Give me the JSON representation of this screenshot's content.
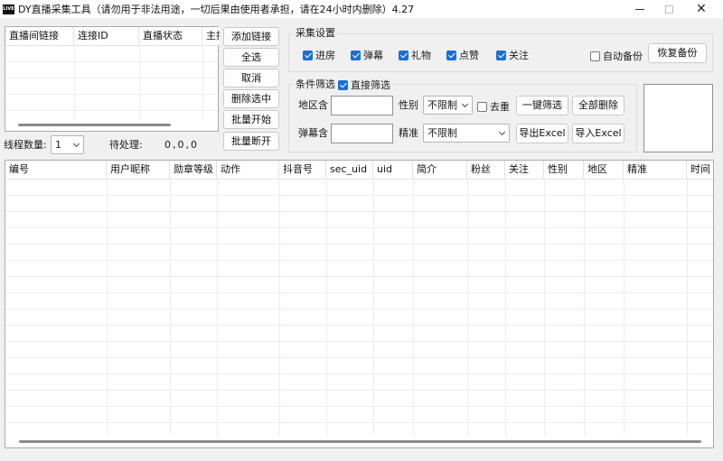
{
  "window": {
    "icon_text": "LIVE",
    "title": "DY直播采集工具（请勿用于非法用途，一切后果由使用者承担，请在24小时内删除）4.27"
  },
  "rooms": {
    "headers": [
      "直播间链接",
      "连接ID",
      "直播状态",
      "主持"
    ]
  },
  "side_buttons": {
    "add_link": "添加链接",
    "select_all": "全选",
    "cancel": "取消",
    "delete_selected": "删除选中",
    "batch_start": "批量开始",
    "batch_stop": "批量断开"
  },
  "threads": {
    "label": "线程数量:",
    "value": "1",
    "pending_label": "待处理:",
    "pending_value": "0,0,0"
  },
  "collect": {
    "title": "采集设置",
    "options": [
      {
        "label": "进房",
        "checked": true
      },
      {
        "label": "弹幕",
        "checked": true
      },
      {
        "label": "礼物",
        "checked": true
      },
      {
        "label": "点赞",
        "checked": true
      },
      {
        "label": "关注",
        "checked": true
      }
    ],
    "auto_backup": {
      "label": "自动备份",
      "checked": false
    },
    "restore_button": "恢复备份"
  },
  "filter": {
    "title": "条件筛选",
    "direct": {
      "label": "直接筛选",
      "checked": true
    },
    "region_label": "地区含",
    "region_value": "",
    "gender_label": "性别",
    "gender_value": "不限制",
    "dedupe": {
      "label": "去重",
      "checked": false
    },
    "one_click_button": "一键筛选",
    "delete_all_button": "全部删除",
    "danmu_label": "弹幕含",
    "danmu_value": "",
    "precise_label": "精准",
    "precise_value": "不限制",
    "export_button": "导出Excel",
    "import_button": "导入Excel"
  },
  "results": {
    "headers": [
      "编号",
      "用户昵称",
      "勋章等级",
      "动作",
      "抖音号",
      "sec_uid",
      "uid",
      "简介",
      "粉丝",
      "关注",
      "性别",
      "地区",
      "精准",
      "时间"
    ]
  }
}
